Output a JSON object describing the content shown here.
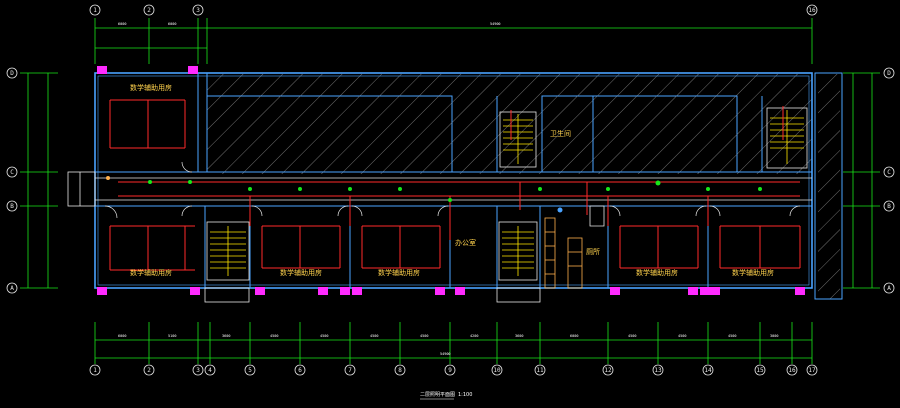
{
  "drawing": {
    "caption": "二层照明平面图",
    "caption_scale": "1:100",
    "colors": {
      "background": "#000000",
      "wall": "#4aa3ff",
      "dimension": "#19e619",
      "wiring": "#ff2a2a",
      "hatch": "#8c8c8c",
      "stair": "#ffe600",
      "fixture": "#ff2aff",
      "label": "#ffd24d"
    }
  },
  "axes": {
    "top": [
      "1",
      "2",
      "3",
      "16"
    ],
    "bottom": [
      "1",
      "2",
      "3",
      "4",
      "5",
      "6",
      "7",
      "8",
      "9",
      "10",
      "11",
      "12",
      "13",
      "14",
      "15",
      "16",
      "17"
    ],
    "left": [
      "D",
      "C",
      "B",
      "A"
    ],
    "right": [
      "D",
      "C",
      "B",
      "A"
    ]
  },
  "rooms": [
    {
      "name": "数学辅助用房"
    },
    {
      "name": "数学辅助用房"
    },
    {
      "name": "数学辅助用房"
    },
    {
      "name": "数学辅助用房"
    },
    {
      "name": "数学辅助用房"
    },
    {
      "name": "数学辅助用房"
    },
    {
      "name": "办公室"
    },
    {
      "name": "卫生间"
    },
    {
      "name": "厕所"
    }
  ]
}
